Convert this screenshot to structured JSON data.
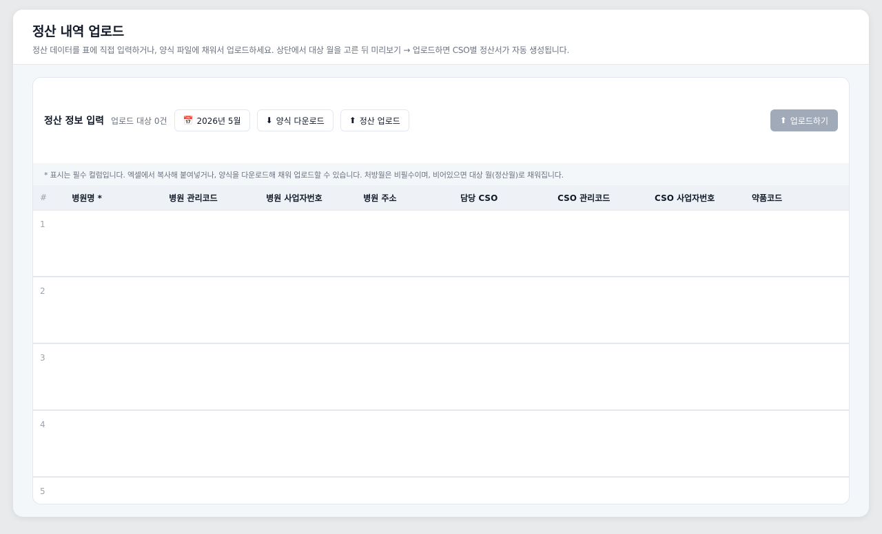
{
  "header": {
    "title": "정산 내역 업로드",
    "description": "정산 데이터를 표에 직접 입력하거나, 양식 파일에 채워서 업로드하세요. 상단에서 대상 월을 고른 뒤 미리보기 → 업로드하면 CSO별 정산서가 자동 생성됩니다."
  },
  "toolbar": {
    "title": "정산 정보 입력",
    "count_label": "업로드 대상 0건",
    "month_icon": "📅",
    "month_label": "2026년 5월",
    "download_icon": "⬇",
    "download_label": "양식 다운로드",
    "upload_icon": "⬆",
    "upload_label": "정산 업로드",
    "submit_icon": "⬆",
    "submit_label": "업로드하기"
  },
  "notice": "* 표시는 필수 컬럼입니다. 엑셀에서 복사해 붙여넣거나, 양식을 다운로드해 채워 업로드할 수 있습니다. 처방월은 비필수이며, 비어있으면 대상 월(정산월)로 채워집니다.",
  "table": {
    "row_num_header": "#",
    "columns": [
      "병원명 *",
      "병원 관리코드",
      "병원 사업자번호",
      "병원 주소",
      "담당 CSO",
      "CSO 관리코드",
      "CSO 사업자번호",
      "약품코드"
    ],
    "rows": [
      "1",
      "2",
      "3",
      "4",
      "5"
    ]
  },
  "colors": {
    "primary_disabled": "#a1aab8",
    "background": "#f4f7fa",
    "border": "#e3e8ee"
  }
}
